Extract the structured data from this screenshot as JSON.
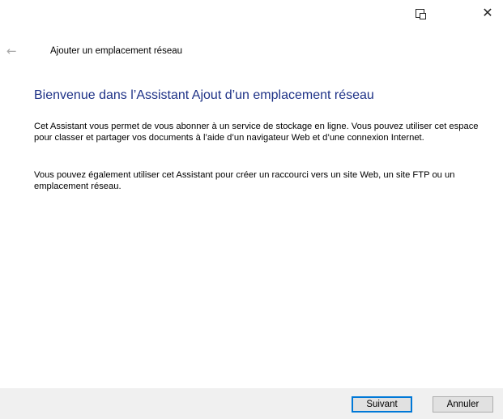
{
  "window": {
    "title": "Ajouter un emplacement réseau",
    "icons": {
      "snap": "snap-window-icon",
      "close": "close-icon",
      "back": "back-arrow-icon"
    }
  },
  "content": {
    "heading": "Bienvenue dans l’Assistant Ajout d’un emplacement réseau",
    "paragraph1": "Cet Assistant vous permet de vous abonner à un service de stockage en ligne. Vous pouvez utiliser cet espace pour classer et partager vos documents à l’aide d’un navigateur Web et d’une connexion Internet.",
    "paragraph2": "Vous pouvez également utiliser cet Assistant pour créer un raccourci vers un site Web, un site FTP ou un emplacement réseau."
  },
  "footer": {
    "next_label": "Suivant",
    "cancel_label": "Annuler"
  },
  "colors": {
    "heading": "#1e3287",
    "accent": "#0078d7",
    "footer_bg": "#f0f0f0"
  }
}
